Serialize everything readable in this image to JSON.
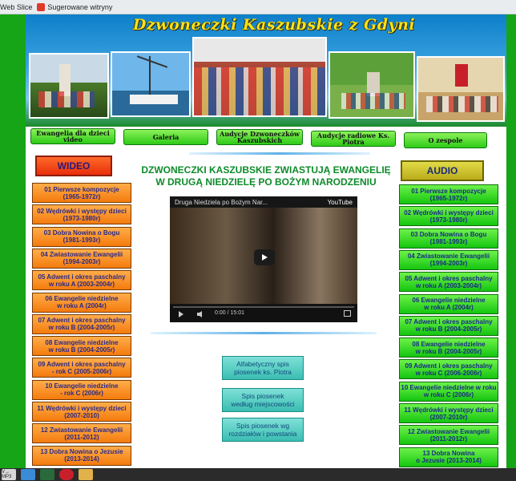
{
  "browser": {
    "bookmarks": [
      {
        "label": "Web Slice",
        "color": "#3a8ad6"
      },
      {
        "label": "Sugerowane witryny",
        "color": "#e0392a"
      }
    ]
  },
  "site": {
    "title": "Dzwoneczki Kaszubskie z Gdyni"
  },
  "nav": [
    {
      "label": "Ewangelia dla dzieci video"
    },
    {
      "label": "Galeria"
    },
    {
      "label": "Audycje Dzwoneczków Kaszubskich"
    },
    {
      "label": "Audycje radiowe Ks. Piotra"
    },
    {
      "label": "O zespole"
    }
  ],
  "video": {
    "heading": "WIDEO",
    "items": [
      {
        "line1": "01 Pierwsze kompozycje",
        "line2": "(1965-1972r)"
      },
      {
        "line1": "02 Wędrówki i występy dzieci",
        "line2": "(1973-1980r)"
      },
      {
        "line1": "03 Dobra Nowina o Bogu",
        "line2": "(1981-1993r)"
      },
      {
        "line1": "04 Zwiastowanie Ewangelii",
        "line2": "(1994-2003r)"
      },
      {
        "line1": "05 Adwent i okres paschalny",
        "line2": "w roku A (2003-2004r)"
      },
      {
        "line1": "06 Ewangelie niedzielne",
        "line2": "w roku A (2004r)"
      },
      {
        "line1": "07 Adwent i okres paschalny",
        "line2": "w roku B (2004-2005r)"
      },
      {
        "line1": "08 Ewangelie niedzielne",
        "line2": "w roku B (2004-2005r)"
      },
      {
        "line1": "09 Adwent i okres paschalny",
        "line2": "- rok C (2005-2006r)"
      },
      {
        "line1": "10 Ewangelie niedzielne",
        "line2": "- rok C (2006r)"
      },
      {
        "line1": "11 Wędrówki i występy dzieci",
        "line2": "(2007-2010)"
      },
      {
        "line1": "12 Zwiastowanie Ewangelii",
        "line2": "(2011-2012)"
      },
      {
        "line1": "13 Dobra Nowina o Jezusie",
        "line2": "(2013-2014)"
      }
    ]
  },
  "audio": {
    "heading": "AUDIO",
    "items": [
      {
        "line1": "01 Pierwsze kompozycje",
        "line2": "(1965-1972r)"
      },
      {
        "line1": "02 Wędrówki i występy dzieci",
        "line2": "(1973-1980r)"
      },
      {
        "line1": "03 Dobra Nowina o Bogu",
        "line2": "(1981-1993r)"
      },
      {
        "line1": "04 Zwiastowanie Ewangelii",
        "line2": "(1994-2003r)"
      },
      {
        "line1": "05 Adwent i okres paschalny",
        "line2": "w roku A (2003-2004r)"
      },
      {
        "line1": "06 Ewangelie niedzielne",
        "line2": "w roku A (2004r)"
      },
      {
        "line1": "07 Adwent i okres paschalny",
        "line2": "w roku B (2004-2005r)"
      },
      {
        "line1": "08 Ewangelie niedzielne",
        "line2": "w roku B (2004-2005r)"
      },
      {
        "line1": "09 Adwent i okres paschalny",
        "line2": "w roku C (2006-2006r)"
      },
      {
        "line1": "10 Ewangelie niedzielne w roku",
        "line2": "w roku C (2006r)"
      },
      {
        "line1": "11 Wędrówki i występy dzieci",
        "line2": "(2007-2010r)"
      },
      {
        "line1": "12 Zwiastowanie Ewangelii",
        "line2": "(2011-2012r)"
      },
      {
        "line1": "13 Dobra Nowina",
        "line2": "o Jezusie (2013-2014)"
      }
    ]
  },
  "main": {
    "headline_line1": "DZWONECZKI KASZUBSKIE ZWIASTUJĄ EWANGELIĘ",
    "headline_line2": "W DRUGĄ NIEDZIELĘ PO BOŻYM NARODZENIU",
    "player": {
      "title": "Druga Niedziela po Bożym Nar...",
      "brand": "YouTube",
      "time": "0:00 / 15:01"
    },
    "buttons": [
      {
        "line1": "Alfabetyczny spis",
        "line2": "piosenek ks. Piotra"
      },
      {
        "line1": "Spis piosenek",
        "line2": "według miejscowości"
      },
      {
        "line1": "Spis piosenek wg",
        "line2": "rozdziałów i powstania"
      }
    ]
  },
  "taskbar": {
    "items": [
      {
        "label": "V→ MP3"
      }
    ]
  }
}
